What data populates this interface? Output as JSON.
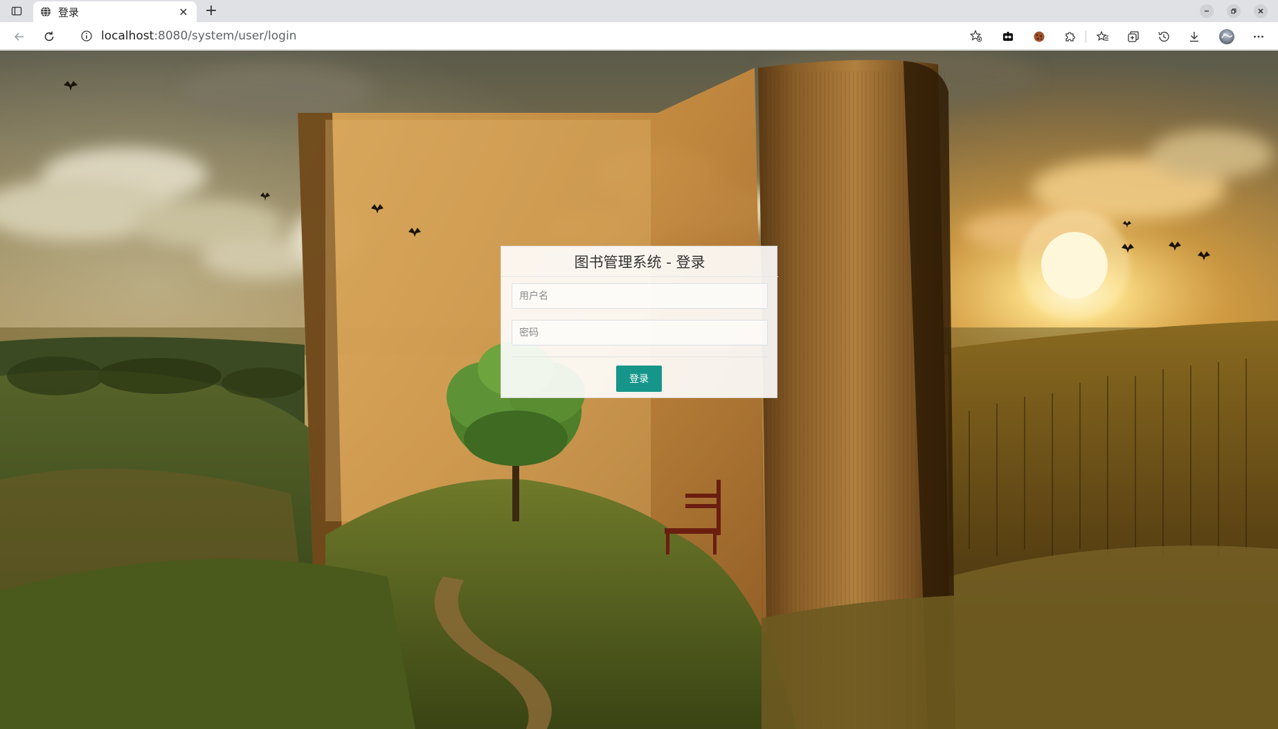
{
  "browser": {
    "tab": {
      "title": "登录",
      "close_glyph": "✕",
      "favicon": "globe-icon"
    },
    "new_tab_glyph": "+",
    "window_controls": [
      "minimize-icon",
      "restore-icon",
      "close-icon"
    ],
    "address_bar": {
      "url_host": "localhost",
      "url_path": ":8080/system/user/login"
    },
    "toolbar_icons": [
      "extension-icon",
      "cookie-icon",
      "puzzle-icon",
      "favorites-icon",
      "collections-icon",
      "history-icon",
      "download-icon",
      "profile-avatar",
      "more-icon"
    ]
  },
  "page": {
    "background": "book-landscape-image",
    "login": {
      "title": "图书管理系统 - 登录",
      "username_placeholder": "用户名",
      "password_placeholder": "密码",
      "submit_label": "登录"
    },
    "colors": {
      "button": "#16968a"
    }
  }
}
